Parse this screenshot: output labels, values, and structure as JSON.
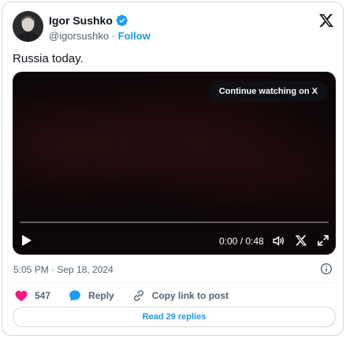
{
  "author": {
    "name": "Igor Sushko",
    "handle": "@igorsushko",
    "separator": "·",
    "follow_label": "Follow"
  },
  "tweet": {
    "text": "Russia today.",
    "timestamp": "5:05 PM · Sep 18, 2024"
  },
  "video": {
    "continue_label": "Continue watching on X",
    "time_display": "0:00 / 0:48",
    "progress": 0
  },
  "actions": {
    "likes": "547",
    "reply_label": "Reply",
    "copy_link_label": "Copy link to post"
  },
  "read_replies_label": "Read 29 replies",
  "colors": {
    "accent": "#1d9bf0",
    "like": "#f91880",
    "text_secondary": "#536471",
    "border": "#cfd9de"
  },
  "icons": [
    "verified-badge-icon",
    "x-logo-icon",
    "play-icon",
    "volume-icon",
    "x-brand-icon",
    "fullscreen-icon",
    "info-icon",
    "heart-icon",
    "reply-bubble-icon",
    "link-icon"
  ]
}
